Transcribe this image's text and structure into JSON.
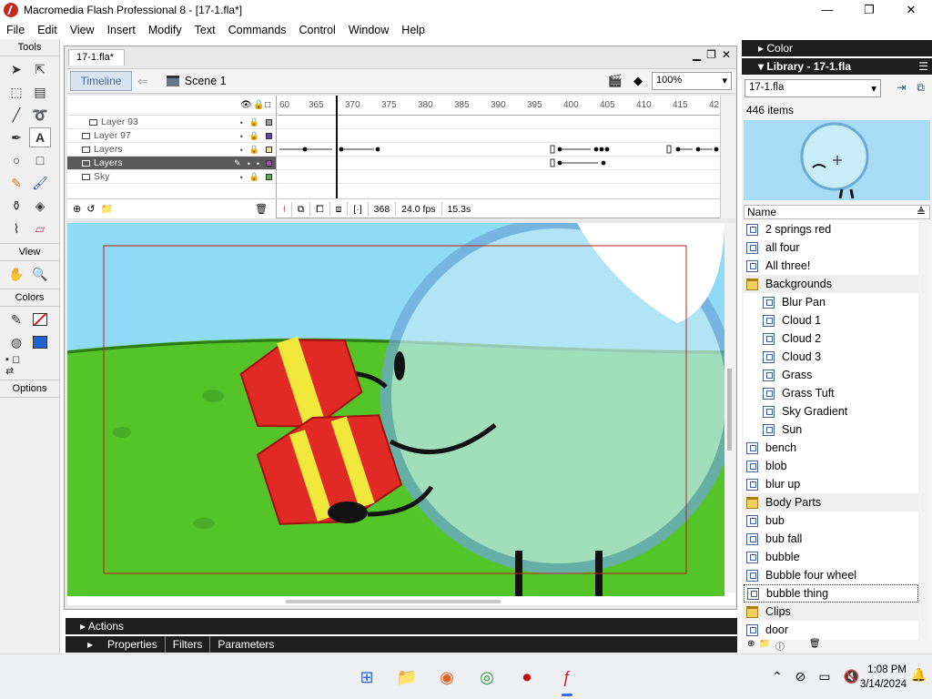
{
  "window": {
    "title": "Macromedia Flash Professional 8 - [17-1.fla*]"
  },
  "menu": [
    "File",
    "Edit",
    "View",
    "Insert",
    "Modify",
    "Text",
    "Commands",
    "Control",
    "Window",
    "Help"
  ],
  "tools": {
    "header": "Tools",
    "view_label": "View",
    "colors_label": "Colors",
    "options_label": "Options"
  },
  "document": {
    "tab": "17-1.fla*",
    "timeline_button": "Timeline",
    "scene": "Scene 1",
    "zoom": "100%"
  },
  "timeline": {
    "layers": [
      {
        "name": "Layer 93",
        "selected": false,
        "color": "#a0a0a0"
      },
      {
        "name": "Layer 97",
        "selected": false,
        "color": "#6040c0"
      },
      {
        "name": "Layers",
        "selected": false,
        "color": "#f0f080"
      },
      {
        "name": "Layers",
        "selected": true,
        "color": "#b040c0"
      },
      {
        "name": "Sky",
        "selected": false,
        "color": "#40c040"
      }
    ],
    "ruler": [
      "60",
      "365",
      "370",
      "375",
      "380",
      "385",
      "390",
      "395",
      "400",
      "405",
      "410",
      "415",
      "42"
    ],
    "current_frame": "368",
    "fps": "24.0 fps",
    "elapsed": "15.3s"
  },
  "panels": {
    "actions": "Actions",
    "properties_tabs": [
      "Properties",
      "Filters",
      "Parameters"
    ],
    "color": "Color",
    "library_title": "Library - 17-1.fla"
  },
  "library": {
    "doc": "17-1.fla",
    "count": "446 items",
    "column": "Name",
    "items": [
      {
        "name": "2 springs red",
        "type": "symbol",
        "child": false
      },
      {
        "name": "all four",
        "type": "symbol",
        "child": false
      },
      {
        "name": "All three!",
        "type": "symbol",
        "child": false
      },
      {
        "name": "Backgrounds",
        "type": "folder",
        "child": false
      },
      {
        "name": "Blur Pan",
        "type": "symbol",
        "child": true
      },
      {
        "name": "Cloud 1",
        "type": "symbol",
        "child": true
      },
      {
        "name": "Cloud 2",
        "type": "symbol",
        "child": true
      },
      {
        "name": "Cloud 3",
        "type": "symbol",
        "child": true
      },
      {
        "name": "Grass",
        "type": "symbol",
        "child": true
      },
      {
        "name": "Grass Tuft",
        "type": "symbol",
        "child": true
      },
      {
        "name": "Sky Gradient",
        "type": "symbol",
        "child": true
      },
      {
        "name": "Sun",
        "type": "symbol",
        "child": true
      },
      {
        "name": "bench",
        "type": "symbol",
        "child": false
      },
      {
        "name": "blob",
        "type": "symbol",
        "child": false
      },
      {
        "name": "blur up",
        "type": "symbol",
        "child": false
      },
      {
        "name": "Body Parts",
        "type": "folder",
        "child": false
      },
      {
        "name": "bub",
        "type": "symbol",
        "child": false
      },
      {
        "name": "bub fall",
        "type": "symbol",
        "child": false
      },
      {
        "name": "bubble",
        "type": "symbol",
        "child": false
      },
      {
        "name": "Bubble four wheel",
        "type": "symbol",
        "child": false
      },
      {
        "name": "bubble thing",
        "type": "symbol",
        "child": false
      },
      {
        "name": "Clips",
        "type": "folder",
        "child": false
      },
      {
        "name": "door",
        "type": "symbol",
        "child": false
      }
    ]
  },
  "taskbar": {
    "time": "1:08 PM",
    "date": "3/14/2024"
  }
}
